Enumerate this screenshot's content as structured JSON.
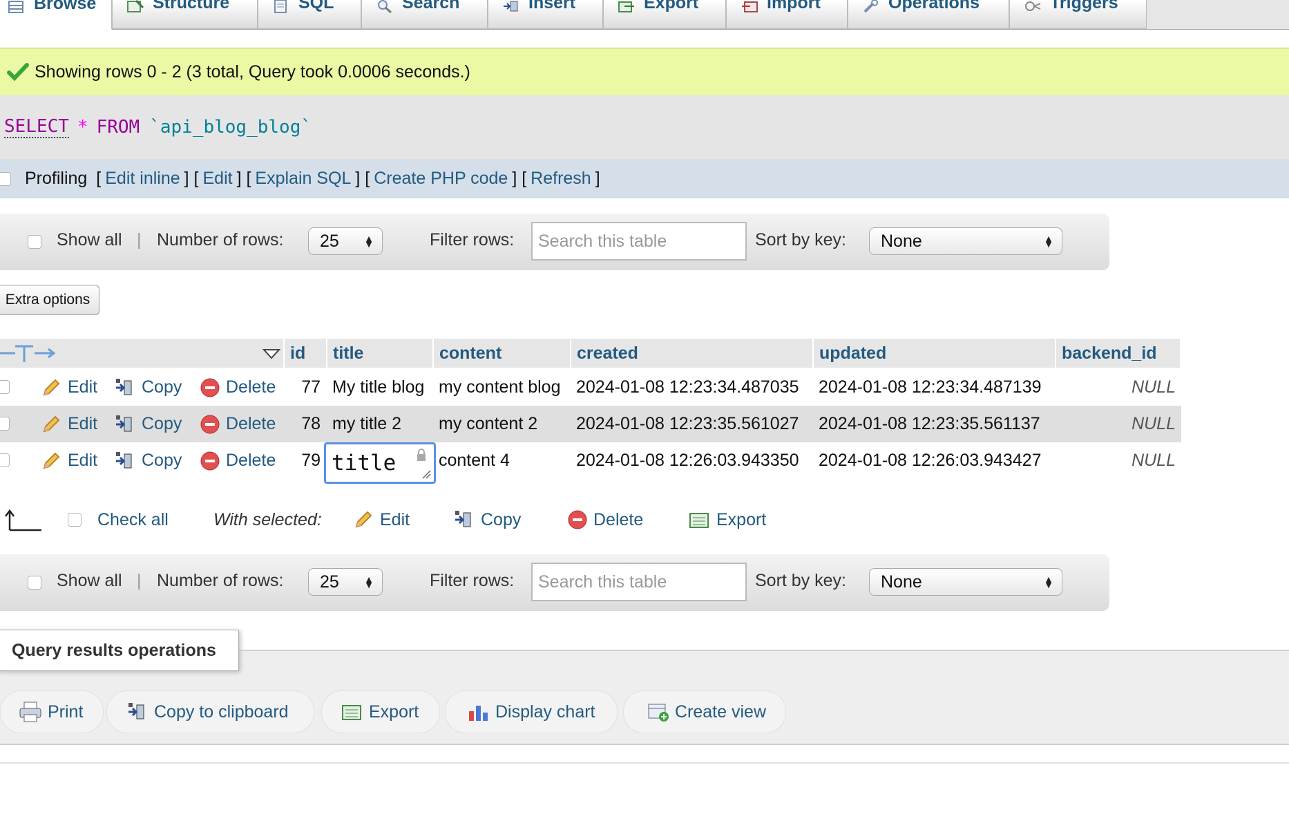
{
  "tabs": [
    {
      "label": "Browse",
      "icon": "browse-icon",
      "active": true
    },
    {
      "label": "Structure",
      "icon": "structure-icon"
    },
    {
      "label": "SQL",
      "icon": "sql-icon"
    },
    {
      "label": "Search",
      "icon": "search-icon"
    },
    {
      "label": "Insert",
      "icon": "insert-icon"
    },
    {
      "label": "Export",
      "icon": "export-icon"
    },
    {
      "label": "Import",
      "icon": "import-icon"
    },
    {
      "label": "Operations",
      "icon": "wrench-icon"
    },
    {
      "label": "Triggers",
      "icon": "triggers-icon"
    }
  ],
  "success_message": "Showing rows 0 - 2 (3 total, Query took 0.0006 seconds.)",
  "query": {
    "select": "SELECT",
    "star": "*",
    "from": "FROM",
    "table": "`api_blog_blog`"
  },
  "profiling": {
    "label": "Profiling",
    "links": [
      "Edit inline",
      "Edit",
      "Explain SQL",
      "Create PHP code",
      "Refresh"
    ]
  },
  "nav": {
    "show_all": "Show all",
    "number_of_rows_label": "Number of rows:",
    "number_of_rows_value": "25",
    "filter_label": "Filter rows:",
    "filter_placeholder": "Search this table",
    "sort_label": "Sort by key:",
    "sort_value": "None"
  },
  "extra_options": "Extra options",
  "table": {
    "columns": [
      "id",
      "title",
      "content",
      "created",
      "updated",
      "backend_id"
    ],
    "row_actions": {
      "edit": "Edit",
      "copy": "Copy",
      "delete": "Delete"
    },
    "rows": [
      {
        "id": "77",
        "title": "My title blog",
        "content": "my content blog",
        "created": "2024-01-08 12:23:34.487035",
        "updated": "2024-01-08 12:23:34.487139",
        "backend_id": "NULL"
      },
      {
        "id": "78",
        "title": "my title 2",
        "content": "my content 2",
        "created": "2024-01-08 12:23:35.561027",
        "updated": "2024-01-08 12:23:35.561137",
        "backend_id": "NULL"
      },
      {
        "id": "79",
        "title": "title",
        "content": "content 4",
        "created": "2024-01-08 12:26:03.943350",
        "updated": "2024-01-08 12:26:03.943427",
        "backend_id": "NULL"
      }
    ]
  },
  "with_selected": {
    "check_all": "Check all",
    "label": "With selected:",
    "edit": "Edit",
    "copy": "Copy",
    "delete": "Delete",
    "export": "Export"
  },
  "query_results_operations": {
    "legend": "Query results operations",
    "buttons": [
      "Print",
      "Copy to clipboard",
      "Export",
      "Display chart",
      "Create view"
    ]
  }
}
